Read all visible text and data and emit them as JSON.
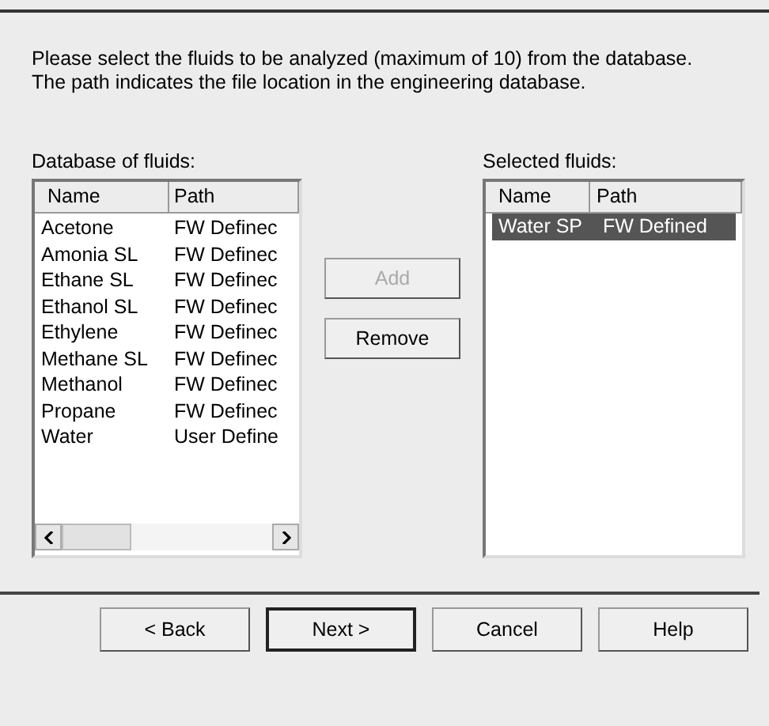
{
  "instructions": "Please select the fluids to be analyzed (maximum of 10) from the database. The path indicates the file location in the engineering database.",
  "database": {
    "label": "Database of fluids:",
    "columns": [
      "Name",
      "Path"
    ],
    "rows": [
      {
        "name": "Acetone",
        "path": "FW Definec",
        "selected": false
      },
      {
        "name": "Amonia SL",
        "path": "FW Definec",
        "selected": false
      },
      {
        "name": "Ethane SL",
        "path": "FW Definec",
        "selected": false
      },
      {
        "name": "Ethanol SL",
        "path": "FW Definec",
        "selected": false
      },
      {
        "name": "Ethylene",
        "path": "FW Definec",
        "selected": false
      },
      {
        "name": "Methane SL",
        "path": "FW Definec",
        "selected": false
      },
      {
        "name": "Methanol",
        "path": "FW Definec",
        "selected": false
      },
      {
        "name": "Propane",
        "path": "FW Definec",
        "selected": false
      },
      {
        "name": "Water",
        "path": "User Define",
        "selected": false
      }
    ]
  },
  "actions": [
    {
      "label": "Add",
      "disabled": true
    },
    {
      "label": "Remove",
      "disabled": false
    }
  ],
  "selected_fluids": {
    "label": "Selected fluids:",
    "columns": [
      "Name",
      "Path"
    ],
    "rows": [
      {
        "name": "Water SP",
        "path": "FW Defined",
        "selected": true
      }
    ]
  },
  "buttons": [
    {
      "label": "< Back",
      "default": false
    },
    {
      "label": "Next >",
      "default": true
    },
    {
      "label": "Cancel",
      "default": false
    },
    {
      "label": "Help",
      "default": false
    }
  ]
}
